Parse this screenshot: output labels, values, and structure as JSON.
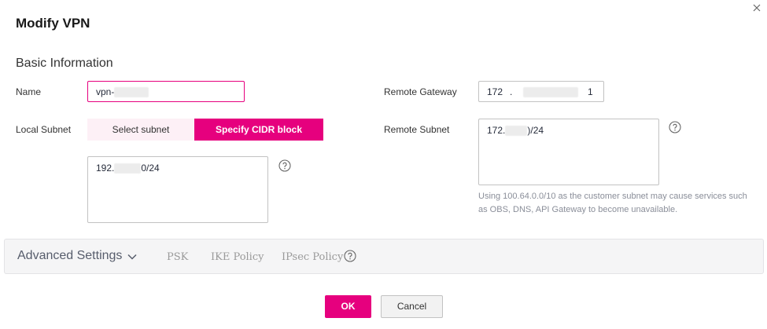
{
  "dialog": {
    "title": "Modify VPN",
    "close_icon": "close-icon"
  },
  "basic": {
    "section_title": "Basic Information",
    "name_label": "Name",
    "name_value": "vpn-",
    "local_subnet_label": "Local Subnet",
    "select_subnet_label": "Select subnet",
    "specify_cidr_label": "Specify CIDR block",
    "local_cidr_prefix": "192.",
    "local_cidr_suffix": "0/24",
    "remote_gateway_label": "Remote Gateway",
    "remote_gateway_part1": "172",
    "remote_gateway_dot": ".",
    "remote_gateway_part_last": "1",
    "remote_subnet_label": "Remote Subnet",
    "remote_subnet_prefix": "172.",
    "remote_subnet_suffix": ")/24",
    "hint_text": "Using 100.64.0.0/10 as the customer subnet may cause services such as OBS, DNS, API Gateway to become unavailable."
  },
  "advanced": {
    "title": "Advanced Settings",
    "tabs": [
      "PSK",
      "IKE Policy",
      "IPsec Policy"
    ]
  },
  "footer": {
    "ok_label": "OK",
    "cancel_label": "Cancel"
  },
  "colors": {
    "accent": "#e6007e",
    "accent_light": "#fdf0f6"
  }
}
